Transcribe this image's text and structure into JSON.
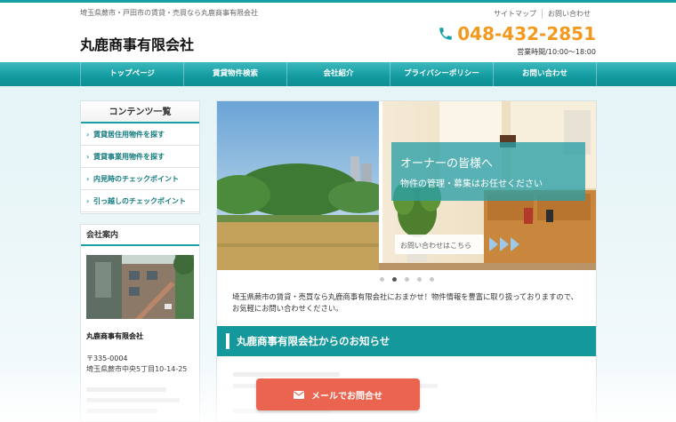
{
  "header": {
    "tagline": "埼玉県蕨市・戸田市の賃貸・売買なら丸鹿商事有限会社",
    "site_title": "丸鹿商事有限会社",
    "top_links": [
      "サイトマップ",
      "お問い合わせ"
    ],
    "phone": "048-432-2851",
    "hours": "営業時間/10:00〜18:00"
  },
  "nav": {
    "items": [
      "トップページ",
      "賃貸物件検索",
      "会社紹介",
      "プライバシーポリシー",
      "お問い合わせ"
    ]
  },
  "sidebar": {
    "contents_title": "コンテンツ一覧",
    "contents_items": [
      "賃貸居住用物件を探す",
      "賃貸事業用物件を探す",
      "内見時のチェックポイント",
      "引っ越しのチェックポイント"
    ],
    "company_title": "会社案内",
    "company_name": "丸鹿商事有限会社",
    "company_zip": "〒335-0004",
    "company_addr": "埼玉県蕨市中央5丁目10-14-25"
  },
  "slider": {
    "headline": "オーナーの皆様へ",
    "subline": "物件の管理・募集はお任せください",
    "cta": "お問い合わせはこちら",
    "dots": 5,
    "active_dot": 1
  },
  "main": {
    "intro": "埼玉県蕨市の賃貸・売買なら丸鹿商事有限会社におまかせ！物件情報を豊富に取り扱っておりますので、お気軽にお問い合わせください。",
    "news_title": "丸鹿商事有限会社からのお知らせ"
  },
  "mail_button": {
    "label": "メールでお問合せ"
  },
  "colors": {
    "accent": "#17a0a6",
    "phone": "#f39a1e",
    "mail_button": "#ea6450"
  }
}
